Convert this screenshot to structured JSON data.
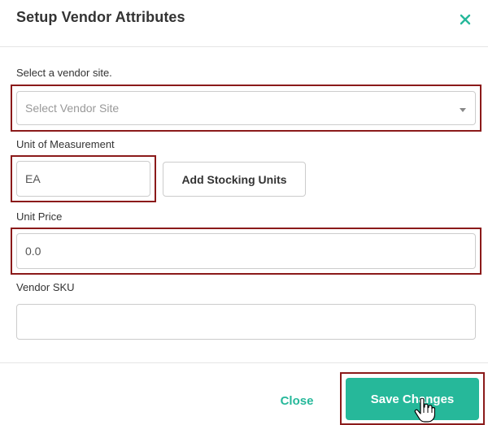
{
  "modal": {
    "title": "Setup Vendor Attributes",
    "close_icon": "close-icon"
  },
  "vendor_site": {
    "label": "Select a vendor site.",
    "placeholder": "Select Vendor Site",
    "caret_icon": "caret-down-icon"
  },
  "unit_of_measurement": {
    "label": "Unit of Measurement",
    "value": "EA",
    "add_button_label": "Add Stocking Units"
  },
  "unit_price": {
    "label": "Unit Price",
    "value": "0.0"
  },
  "vendor_sku": {
    "label": "Vendor SKU",
    "value": ""
  },
  "footer": {
    "close_label": "Close",
    "save_label": "Save Changes"
  },
  "colors": {
    "accent": "#26b89a",
    "highlight": "#8b1a1a",
    "text": "#333333"
  }
}
